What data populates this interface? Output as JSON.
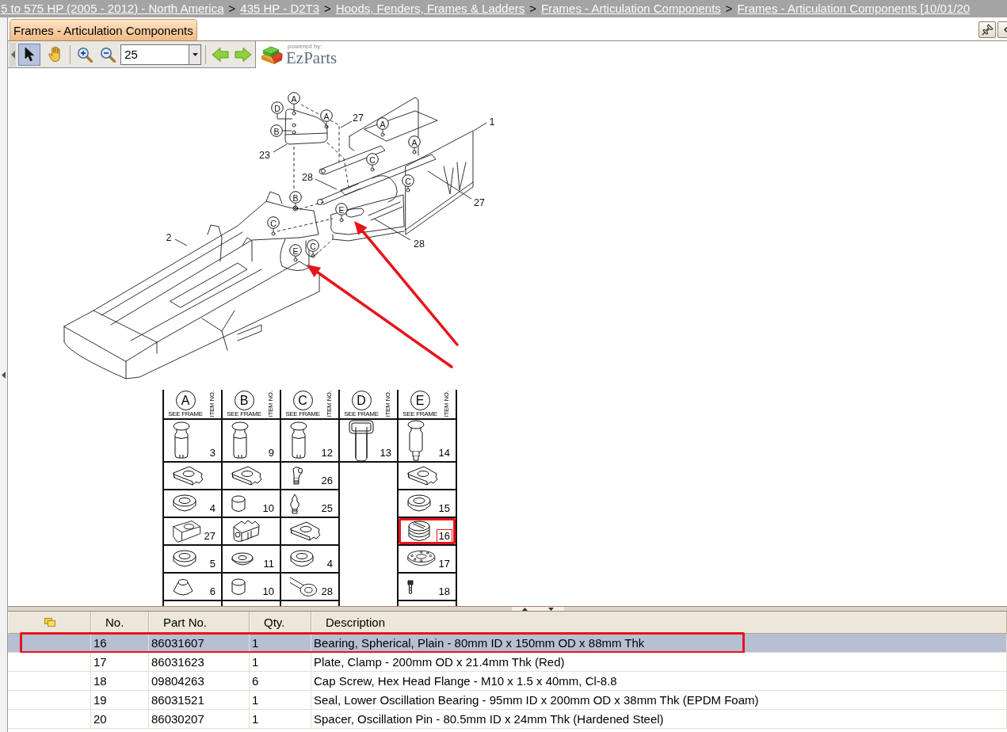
{
  "breadcrumb": [
    {
      "kind": "link",
      "text": "5 to 575 HP (2005 - 2012) - North America"
    },
    {
      "kind": "separator",
      "text": ">"
    },
    {
      "kind": "link",
      "text": "435 HP - D2T3"
    },
    {
      "kind": "separator",
      "text": ">"
    },
    {
      "kind": "link",
      "text": "Hoods, Fenders, Frames & Ladders"
    },
    {
      "kind": "separator",
      "text": ">"
    },
    {
      "kind": "link",
      "text": "Frames - Articulation Components"
    },
    {
      "kind": "separator",
      "text": ">"
    },
    {
      "kind": "link",
      "text": "Frames - Articulation Components [10/01/20"
    }
  ],
  "tabs": [
    {
      "label": "Frames - Articulation Components",
      "selected": true
    }
  ],
  "toolbar": {
    "tools": [
      {
        "kind": "pointer",
        "selected": true
      },
      {
        "kind": "hand",
        "selected": false
      }
    ],
    "zoom": {
      "value": "25"
    },
    "logo": {
      "tagline": "powered by:",
      "name": "EzParts"
    }
  },
  "diagram": {
    "callouts": [
      {
        "kind": "letter",
        "label": "A"
      },
      {
        "kind": "letter",
        "label": "D"
      },
      {
        "kind": "letter",
        "label": "A"
      },
      {
        "kind": "number",
        "label": "27"
      },
      {
        "kind": "letter",
        "label": "A"
      },
      {
        "kind": "number",
        "label": "1"
      },
      {
        "kind": "letter",
        "label": "B"
      },
      {
        "kind": "letter",
        "label": "A"
      },
      {
        "kind": "number",
        "label": "23"
      },
      {
        "kind": "letter",
        "label": "C"
      },
      {
        "kind": "number",
        "label": "28"
      },
      {
        "kind": "letter",
        "label": "C"
      },
      {
        "kind": "letter",
        "label": "B"
      },
      {
        "kind": "number",
        "label": "27"
      },
      {
        "kind": "letter",
        "label": "E"
      },
      {
        "kind": "letter",
        "label": "C"
      },
      {
        "kind": "number",
        "label": "2"
      },
      {
        "kind": "number",
        "label": "28"
      },
      {
        "kind": "letter",
        "label": "C"
      },
      {
        "kind": "letter",
        "label": "E"
      }
    ],
    "grid": {
      "columns": [
        {
          "letter": "A",
          "caption": "SEE FRAME",
          "item_heading": "ITEM NO.",
          "parts": [
            {
              "kind": "pin",
              "item": "3",
              "highlighted": false
            },
            {
              "kind": "bracket",
              "highlighted": false
            },
            {
              "kind": "washer",
              "item": "4",
              "highlighted": false
            },
            {
              "kind": "clamp-plate",
              "item": "27",
              "highlighted": false
            },
            {
              "kind": "washer",
              "item": "5",
              "highlighted": false
            },
            {
              "kind": "cone",
              "item": "6",
              "highlighted": false
            }
          ]
        },
        {
          "letter": "B",
          "caption": "SEE FRAME",
          "item_heading": "ITEM NO.",
          "parts": [
            {
              "kind": "pin",
              "item": "9",
              "highlighted": false
            },
            {
              "kind": "bracket",
              "highlighted": false
            },
            {
              "kind": "bushing",
              "item": "10",
              "highlighted": false
            },
            {
              "kind": "link",
              "highlighted": false
            },
            {
              "kind": "thin-washer",
              "item": "11",
              "highlighted": false
            },
            {
              "kind": "bushing",
              "item": "10",
              "highlighted": false
            }
          ]
        },
        {
          "letter": "C",
          "caption": "SEE FRAME",
          "item_heading": "ITEM NO.",
          "parts": [
            {
              "kind": "pin",
              "item": "12",
              "highlighted": false
            },
            {
              "kind": "elbow-fitting",
              "item": "26",
              "highlighted": false
            },
            {
              "kind": "grease-fitting",
              "item": "25",
              "highlighted": false
            },
            {
              "kind": "bracket",
              "highlighted": false
            },
            {
              "kind": "washer",
              "item": "4",
              "highlighted": false
            },
            {
              "kind": "rod-end",
              "item": "28",
              "highlighted": false
            }
          ]
        },
        {
          "letter": "D",
          "caption": "SEE FRAME",
          "item_heading": "ITEM NO.",
          "parts": [
            {
              "kind": "handle-pin",
              "item": "13",
              "highlighted": false
            }
          ]
        },
        {
          "letter": "E",
          "caption": "SEE FRAME",
          "item_heading": "ITEM NO.",
          "parts": [
            {
              "kind": "stepped-pin",
              "item": "14",
              "highlighted": false
            },
            {
              "kind": "bracket",
              "highlighted": false
            },
            {
              "kind": "washer",
              "item": "15",
              "highlighted": false
            },
            {
              "kind": "bearing",
              "item": "16",
              "highlighted": true
            },
            {
              "kind": "flange-plate",
              "item": "17",
              "highlighted": false
            },
            {
              "kind": "bolt",
              "item": "18",
              "highlighted": false
            }
          ]
        }
      ]
    }
  },
  "parts_table": {
    "columns": [
      {
        "kind": "icon"
      },
      {
        "kind": "text",
        "label": "No."
      },
      {
        "kind": "text",
        "label": "Part No."
      },
      {
        "kind": "text",
        "label": "Qty."
      },
      {
        "kind": "text",
        "label": "Description"
      }
    ],
    "rows": [
      {
        "no": "16",
        "part_no": "86031607",
        "qty": "1",
        "description": "Bearing, Spherical, Plain - 80mm ID x 150mm OD x 88mm Thk",
        "selected": true,
        "highlighted": true
      },
      {
        "no": "17",
        "part_no": "86031623",
        "qty": "1",
        "description": "Plate, Clamp - 200mm OD x 21.4mm Thk (Red)",
        "selected": false,
        "highlighted": false
      },
      {
        "no": "18",
        "part_no": "09804263",
        "qty": "6",
        "description": "Cap Screw, Hex Head Flange - M10 x 1.5 x 40mm, Cl-8.8",
        "selected": false,
        "highlighted": false
      },
      {
        "no": "19",
        "part_no": "86031521",
        "qty": "1",
        "description": "Seal, Lower Oscillation Bearing - 95mm ID x 200mm OD x 38mm Thk (EPDM Foam)",
        "selected": false,
        "highlighted": false
      },
      {
        "no": "20",
        "part_no": "86030207",
        "qty": "1",
        "description": "Spacer, Oscillation Pin - 80.5mm ID x 24mm Thk (Hardened Steel)",
        "selected": false,
        "highlighted": false
      }
    ]
  }
}
